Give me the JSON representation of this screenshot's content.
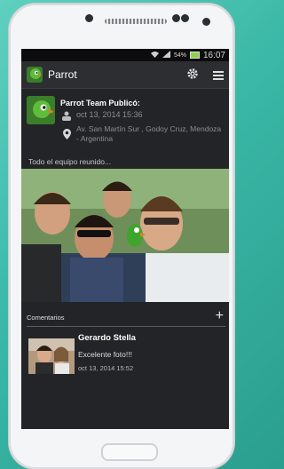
{
  "status": {
    "signal_pct": "54%",
    "time": "16:07"
  },
  "app": {
    "title": "Parrot"
  },
  "post": {
    "author": "Parrot Team Publicó:",
    "date": "oct 13, 2014 15:36",
    "location": "Av. San Martín Sur , Godoy Cruz, Mendoza - Argentina",
    "caption": "Todo el equipo reunido..."
  },
  "comments": {
    "title": "Comentarios",
    "items": [
      {
        "name": "Gerardo Stella",
        "text": "Excelente foto!!!",
        "date": "oct 13, 2014 15:52"
      }
    ]
  }
}
